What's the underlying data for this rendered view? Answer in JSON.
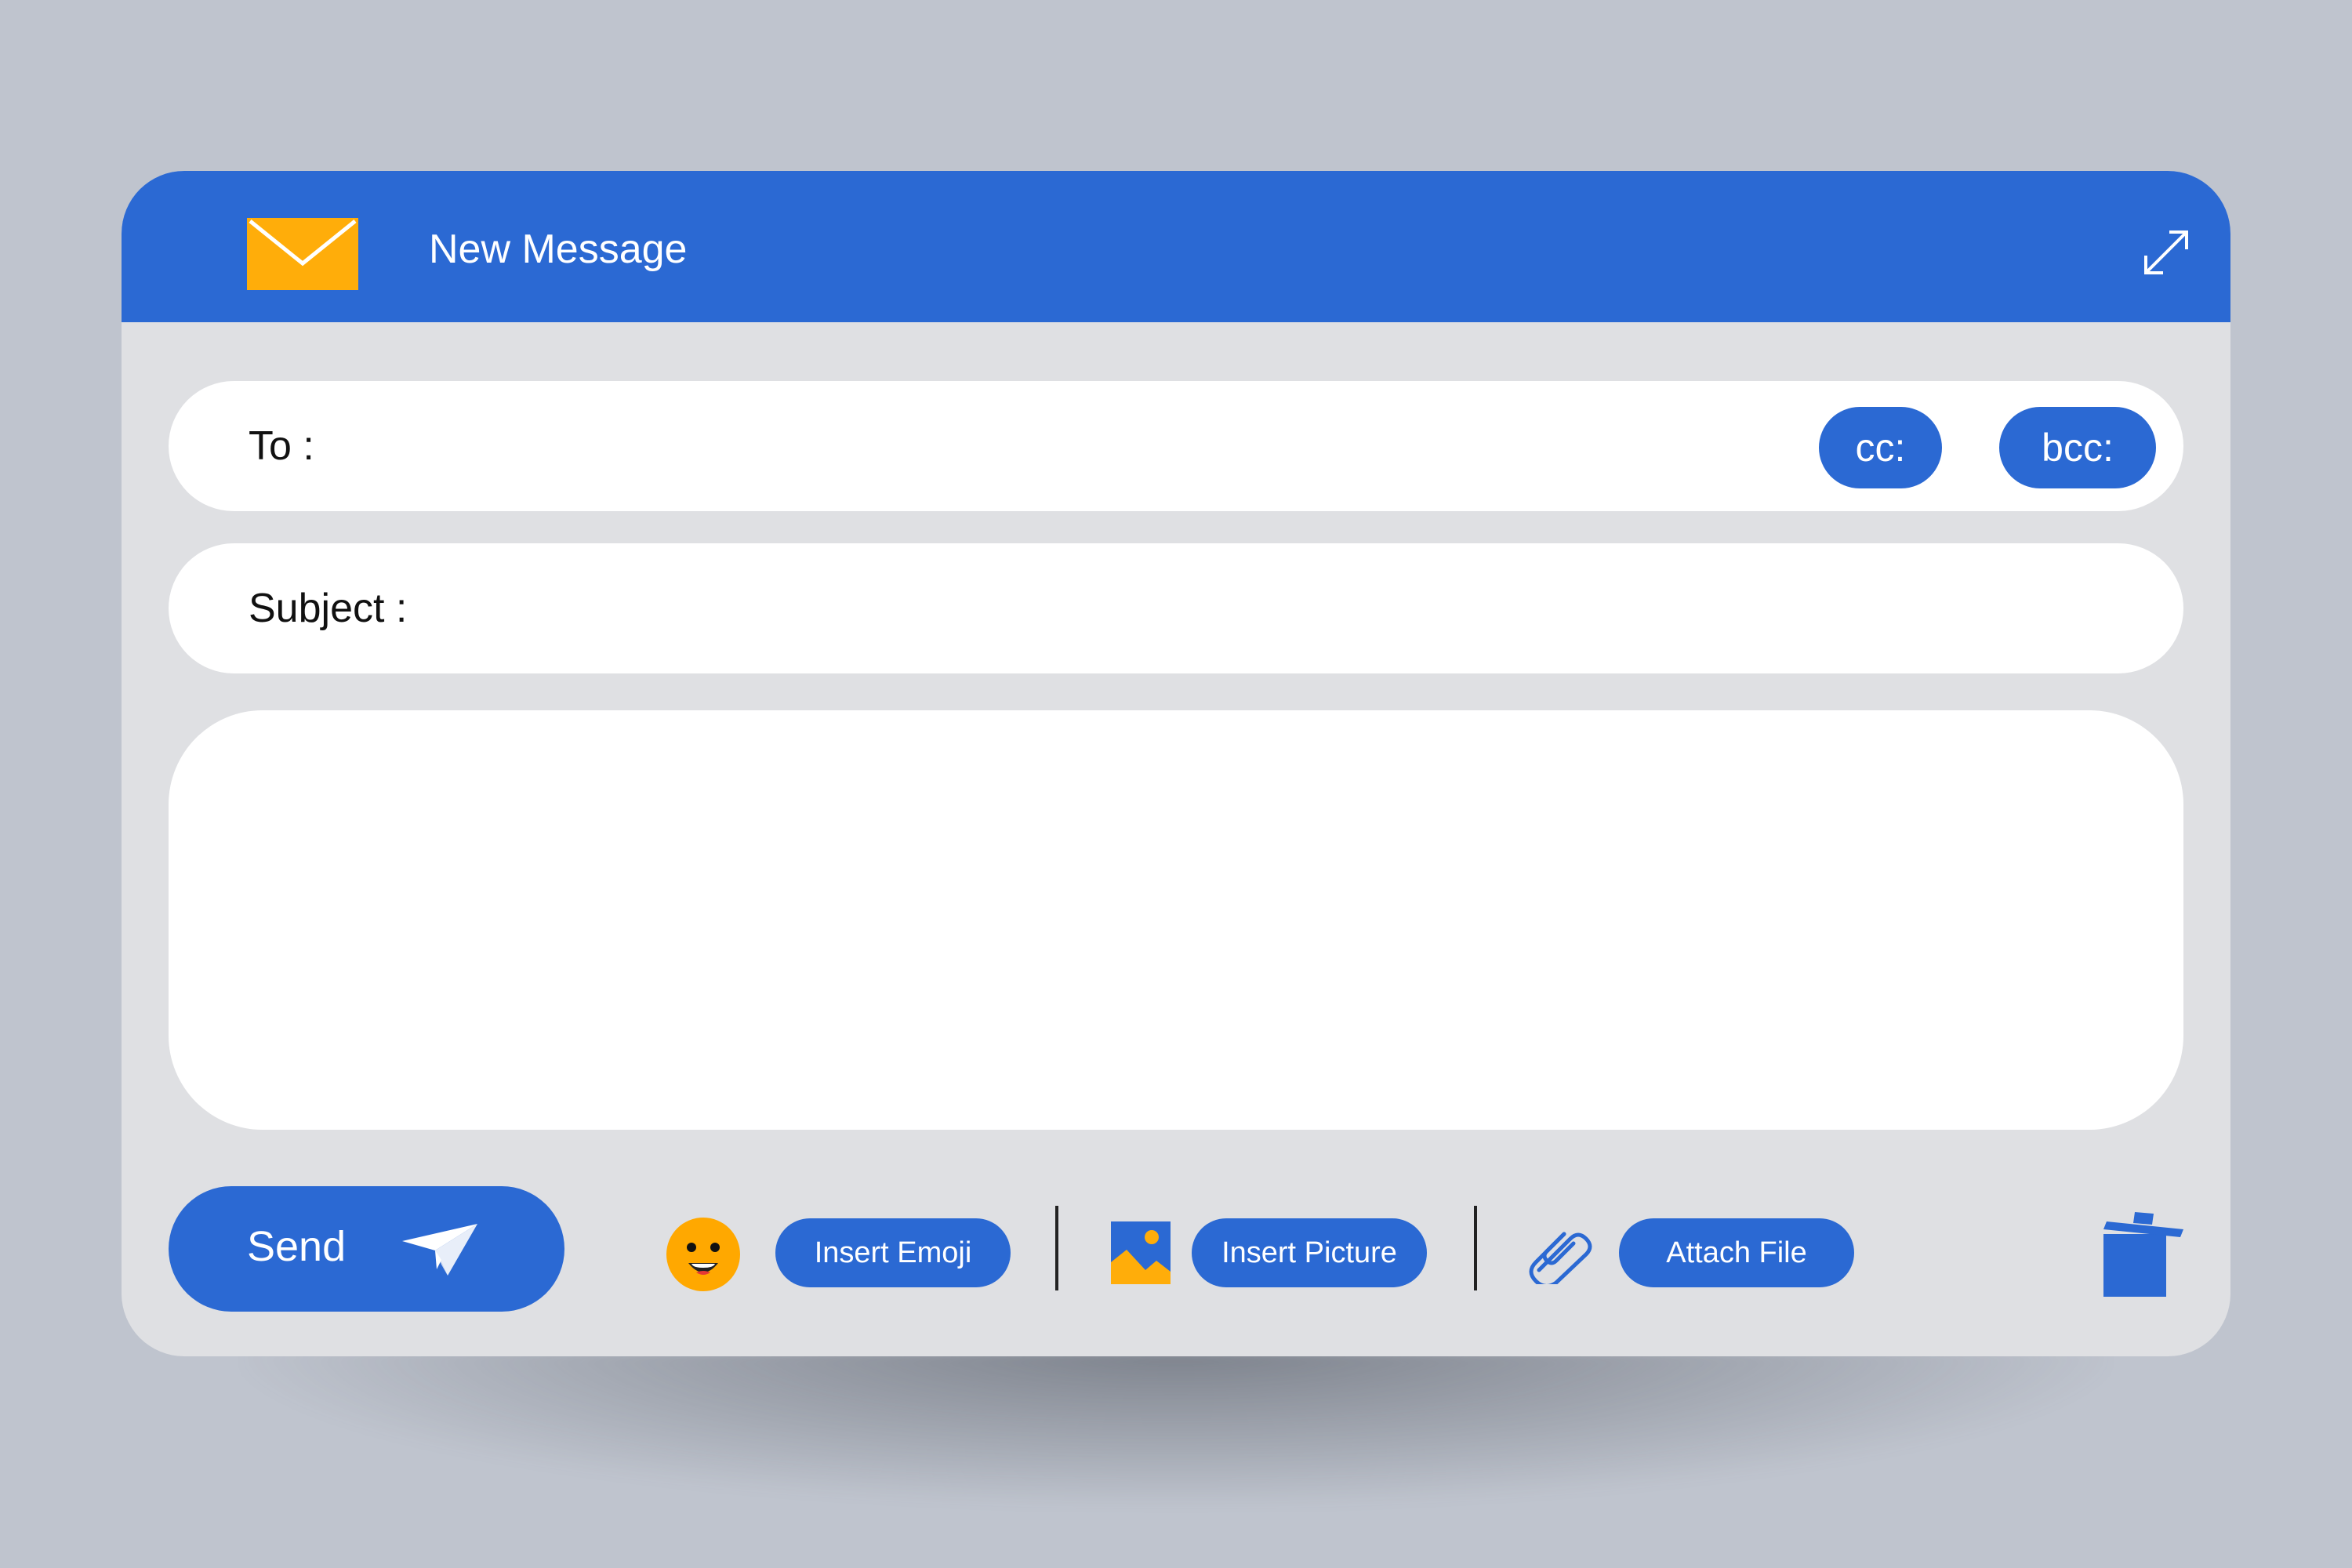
{
  "window": {
    "title": "New Message",
    "icons": {
      "app": "envelope-icon",
      "expand": "expand-icon"
    }
  },
  "fields": {
    "to_label": "To :",
    "subject_label": "Subject :",
    "cc_label": "cc:",
    "bcc_label": "bcc:"
  },
  "toolbar": {
    "send_label": "Send",
    "send_icon": "paper-plane-icon",
    "emoji_label": "Insert Emoji",
    "emoji_icon": "smiley-icon",
    "picture_label": "Insert Picture",
    "picture_icon": "image-icon",
    "attach_label": "Attach File",
    "attach_icon": "paperclip-icon",
    "delete_icon": "trash-icon"
  },
  "colors": {
    "accent": "#2b69d3",
    "envelope": "#ffad0a",
    "emoji": "#ffa800",
    "background": "#bfc4ce",
    "panel": "#dfe0e3"
  }
}
